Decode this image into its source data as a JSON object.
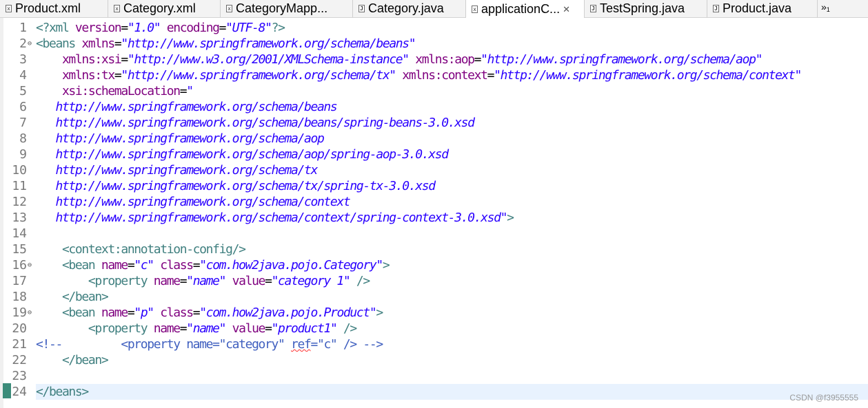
{
  "tabs": [
    {
      "label": "Product.xml",
      "type": "xml"
    },
    {
      "label": "Category.xml",
      "type": "xml"
    },
    {
      "label": "CategoryMapp...",
      "type": "xml"
    },
    {
      "label": "Category.java",
      "type": "java"
    },
    {
      "label": "applicationC...",
      "type": "xml",
      "active": true,
      "close": "✕"
    },
    {
      "label": "TestSpring.java",
      "type": "java"
    },
    {
      "label": "Product.java",
      "type": "java"
    }
  ],
  "overflow": {
    "chevron": "»",
    "count": "1"
  },
  "editor": {
    "current_line": 24,
    "folds": [
      2,
      16,
      19
    ],
    "lines": [
      {
        "num": "1",
        "tokens": [
          [
            "tag",
            "<?xml "
          ],
          [
            "attr",
            "version"
          ],
          [
            "eq",
            "="
          ],
          [
            "val",
            "\"1.0\""
          ],
          [
            "attr",
            " encoding"
          ],
          [
            "eq",
            "="
          ],
          [
            "val",
            "\"UTF-8\""
          ],
          [
            "tag",
            "?>"
          ]
        ]
      },
      {
        "num": "2",
        "tokens": [
          [
            "tag",
            "<beans "
          ],
          [
            "attr",
            "xmlns"
          ],
          [
            "eq",
            "="
          ],
          [
            "val",
            "\"http://www.springframework.org/schema/beans\""
          ]
        ]
      },
      {
        "num": "3",
        "tokens": [
          [
            "attr",
            "    xmlns:xsi"
          ],
          [
            "eq",
            "="
          ],
          [
            "val",
            "\"http://www.w3.org/2001/XMLSchema-instance\""
          ],
          [
            "attr",
            " xmlns:aop"
          ],
          [
            "eq",
            "="
          ],
          [
            "val",
            "\"http://www.springframework.org/schema/aop\""
          ]
        ]
      },
      {
        "num": "4",
        "tokens": [
          [
            "attr",
            "    xmlns:tx"
          ],
          [
            "eq",
            "="
          ],
          [
            "val",
            "\"http://www.springframework.org/schema/tx\""
          ],
          [
            "attr",
            " xmlns:context"
          ],
          [
            "eq",
            "="
          ],
          [
            "val",
            "\"http://www.springframework.org/schema/context\""
          ]
        ]
      },
      {
        "num": "5",
        "tokens": [
          [
            "attr",
            "    xsi:schemaLocation"
          ],
          [
            "eq",
            "="
          ],
          [
            "val",
            "\""
          ]
        ]
      },
      {
        "num": "6",
        "tokens": [
          [
            "val",
            "   http://www.springframework.org/schema/beans"
          ]
        ]
      },
      {
        "num": "7",
        "tokens": [
          [
            "val",
            "   http://www.springframework.org/schema/beans/spring-beans-3.0.xsd"
          ]
        ]
      },
      {
        "num": "8",
        "tokens": [
          [
            "val",
            "   http://www.springframework.org/schema/aop"
          ]
        ]
      },
      {
        "num": "9",
        "tokens": [
          [
            "val",
            "   http://www.springframework.org/schema/aop/spring-aop-3.0.xsd"
          ]
        ]
      },
      {
        "num": "10",
        "tokens": [
          [
            "val",
            "   http://www.springframework.org/schema/tx"
          ]
        ]
      },
      {
        "num": "11",
        "tokens": [
          [
            "val",
            "   http://www.springframework.org/schema/tx/spring-tx-3.0.xsd"
          ]
        ]
      },
      {
        "num": "12",
        "tokens": [
          [
            "val",
            "   http://www.springframework.org/schema/context"
          ]
        ]
      },
      {
        "num": "13",
        "tokens": [
          [
            "val",
            "   http://www.springframework.org/schema/context/spring-context-3.0.xsd\""
          ],
          [
            "tag",
            ">"
          ]
        ]
      },
      {
        "num": "14",
        "tokens": []
      },
      {
        "num": "15",
        "tokens": [
          [
            "tag",
            "    <context:annotation-config/>"
          ]
        ]
      },
      {
        "num": "16",
        "tokens": [
          [
            "tag",
            "    <bean "
          ],
          [
            "attr",
            "name"
          ],
          [
            "eq",
            "="
          ],
          [
            "val",
            "\"c\""
          ],
          [
            "attr",
            " class"
          ],
          [
            "eq",
            "="
          ],
          [
            "val",
            "\"com.how2java.pojo.Category\""
          ],
          [
            "tag",
            ">"
          ]
        ]
      },
      {
        "num": "17",
        "tokens": [
          [
            "tag",
            "        <property "
          ],
          [
            "attr",
            "name"
          ],
          [
            "eq",
            "="
          ],
          [
            "val",
            "\"name\""
          ],
          [
            "attr",
            " value"
          ],
          [
            "eq",
            "="
          ],
          [
            "val",
            "\"category 1\""
          ],
          [
            "tag",
            " />"
          ]
        ]
      },
      {
        "num": "18",
        "tokens": [
          [
            "tag",
            "    </bean>"
          ]
        ]
      },
      {
        "num": "19",
        "tokens": [
          [
            "tag",
            "    <bean "
          ],
          [
            "attr",
            "name"
          ],
          [
            "eq",
            "="
          ],
          [
            "val",
            "\"p\""
          ],
          [
            "attr",
            " class"
          ],
          [
            "eq",
            "="
          ],
          [
            "val",
            "\"com.how2java.pojo.Product\""
          ],
          [
            "tag",
            ">"
          ]
        ]
      },
      {
        "num": "20",
        "tokens": [
          [
            "tag",
            "        <property "
          ],
          [
            "attr",
            "name"
          ],
          [
            "eq",
            "="
          ],
          [
            "val",
            "\"name\""
          ],
          [
            "attr",
            " value"
          ],
          [
            "eq",
            "="
          ],
          [
            "val",
            "\"product1\""
          ],
          [
            "tag",
            " />"
          ]
        ]
      },
      {
        "num": "21",
        "tokens": [
          [
            "com",
            "<!--         <property name=\"category\" "
          ],
          [
            "comerr",
            "ref"
          ],
          [
            "com",
            "=\"c\" /> -->"
          ]
        ]
      },
      {
        "num": "22",
        "tokens": [
          [
            "tag",
            "    </bean>"
          ]
        ]
      },
      {
        "num": "23",
        "tokens": []
      },
      {
        "num": "24",
        "tokens": [
          [
            "tag",
            "</beans>"
          ]
        ]
      }
    ]
  },
  "watermark": "CSDN @f3955555"
}
